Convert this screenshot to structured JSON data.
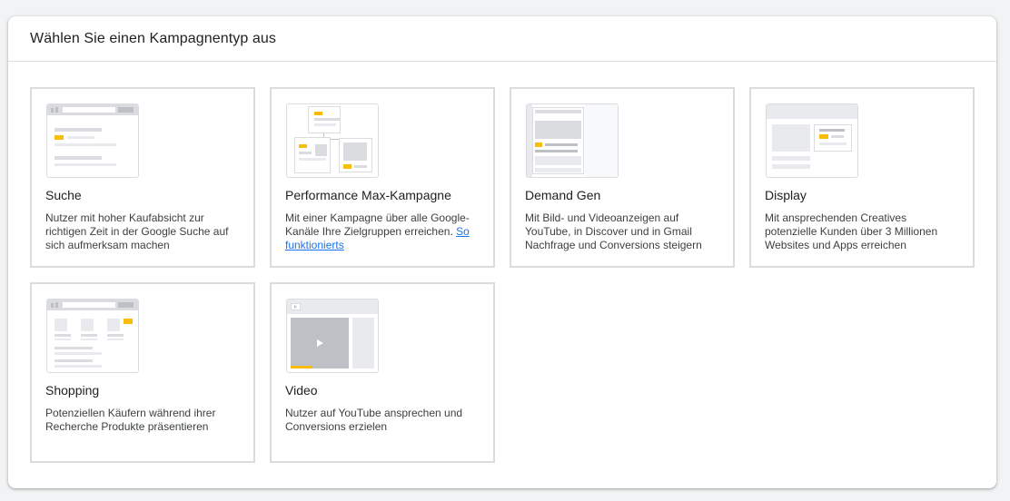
{
  "header": {
    "title": "Wählen Sie einen Kampagnentyp aus"
  },
  "colors": {
    "accent": "#fbbc04",
    "link": "#1a73e8",
    "border": "#dadce0"
  },
  "cards": [
    {
      "title": "Suche",
      "description": "Nutzer mit hoher Kaufabsicht zur richtigen Zeit in der Google Suche auf sich aufmerksam machen",
      "icon": "search-ad-illustration"
    },
    {
      "title": "Performance Max-Kampagne",
      "description": "Mit einer Kampagne über alle Google-Kanäle Ihre Zielgruppen erreichen.",
      "link_label": "So funktionierts",
      "icon": "pmax-illustration"
    },
    {
      "title": "Demand Gen",
      "description": "Mit Bild- und Videoanzeigen auf YouTube, in Discover und in Gmail Nachfrage und Conversions steigern",
      "icon": "demand-gen-illustration"
    },
    {
      "title": "Display",
      "description": "Mit ansprechenden Creatives potenzielle Kunden über 3 Millionen Websites und Apps erreichen",
      "icon": "display-illustration"
    },
    {
      "title": "Shopping",
      "description": "Potenziellen Käufern während ihrer Recherche Produkte präsentieren",
      "icon": "shopping-illustration"
    },
    {
      "title": "Video",
      "description": "Nutzer auf YouTube ansprechen und Conversions erzielen",
      "icon": "video-illustration"
    }
  ]
}
